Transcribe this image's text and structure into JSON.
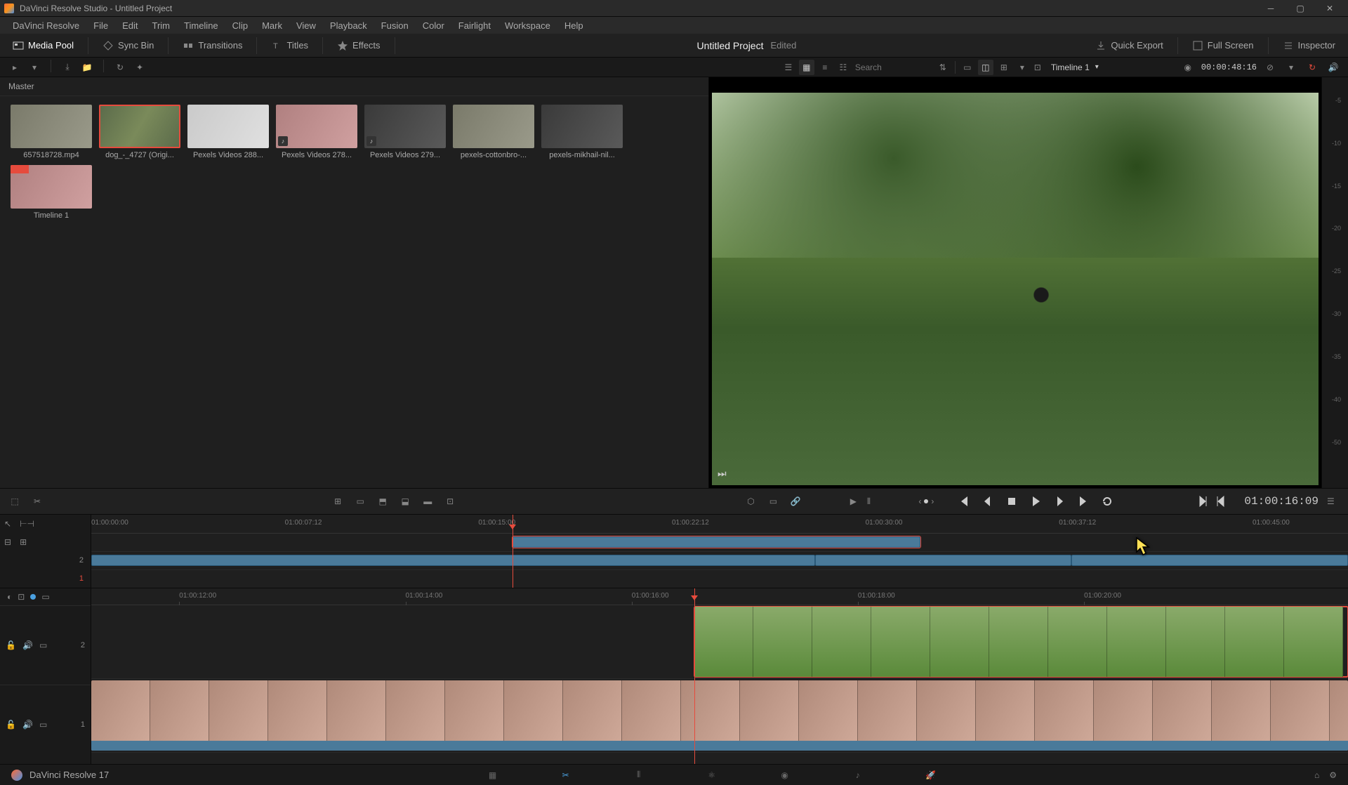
{
  "title_bar": {
    "text": "DaVinci Resolve Studio - Untitled Project"
  },
  "menu": [
    "DaVinci Resolve",
    "File",
    "Edit",
    "Trim",
    "Timeline",
    "Clip",
    "Mark",
    "View",
    "Playback",
    "Fusion",
    "Color",
    "Fairlight",
    "Workspace",
    "Help"
  ],
  "toolbar": {
    "media_pool": "Media Pool",
    "sync_bin": "Sync Bin",
    "transitions": "Transitions",
    "titles": "Titles",
    "effects": "Effects",
    "quick_export": "Quick Export",
    "full_screen": "Full Screen",
    "inspector": "Inspector"
  },
  "project": {
    "name": "Untitled Project",
    "status": "Edited"
  },
  "sub_toolbar": {
    "search_placeholder": "Search",
    "timeline_name": "Timeline 1",
    "timecode": "00:00:48:16"
  },
  "breadcrumb": "Master",
  "thumbs": [
    {
      "label": "657518728.mp4",
      "style": "road"
    },
    {
      "label": "dog_-_4727 (Origi...",
      "style": "",
      "selected": true
    },
    {
      "label": "Pexels Videos 288...",
      "style": "light"
    },
    {
      "label": "Pexels Videos 278...",
      "style": "woman",
      "audio": true
    },
    {
      "label": "Pexels Videos 279...",
      "style": "dark",
      "audio": true
    },
    {
      "label": "pexels-cottonbro-...",
      "style": "road"
    },
    {
      "label": "pexels-mikhail-nil...",
      "style": "dark"
    },
    {
      "label": "Timeline 1",
      "style": "timeline-thumb"
    }
  ],
  "viewer": {
    "timeline_label": "Timeline 1"
  },
  "meter_ticks": [
    "-5",
    "-10",
    "-15",
    "-20",
    "-25",
    "-30",
    "-35",
    "-40",
    "-50"
  ],
  "transport": {
    "timecode": "01:00:16:09"
  },
  "mini_ruler": [
    {
      "label": "01:00:00:00",
      "pos": 0
    },
    {
      "label": "01:00:07:12",
      "pos": 15.4
    },
    {
      "label": "01:00:15:00",
      "pos": 30.8
    },
    {
      "label": "01:00:22:12",
      "pos": 46.2
    },
    {
      "label": "01:00:30:00",
      "pos": 61.6
    },
    {
      "label": "01:00:37:12",
      "pos": 77
    },
    {
      "label": "01:00:45:00",
      "pos": 92.4
    }
  ],
  "tl_ruler": [
    {
      "label": "01:00:12:00",
      "pos": 7
    },
    {
      "label": "01:00:14:00",
      "pos": 25
    },
    {
      "label": "01:00:16:00",
      "pos": 43
    },
    {
      "label": "01:00:18:00",
      "pos": 61
    },
    {
      "label": "01:00:20:00",
      "pos": 79
    }
  ],
  "track_labels": {
    "t2": "2",
    "t1": "1"
  },
  "bottom": {
    "name": "DaVinci Resolve 17"
  }
}
